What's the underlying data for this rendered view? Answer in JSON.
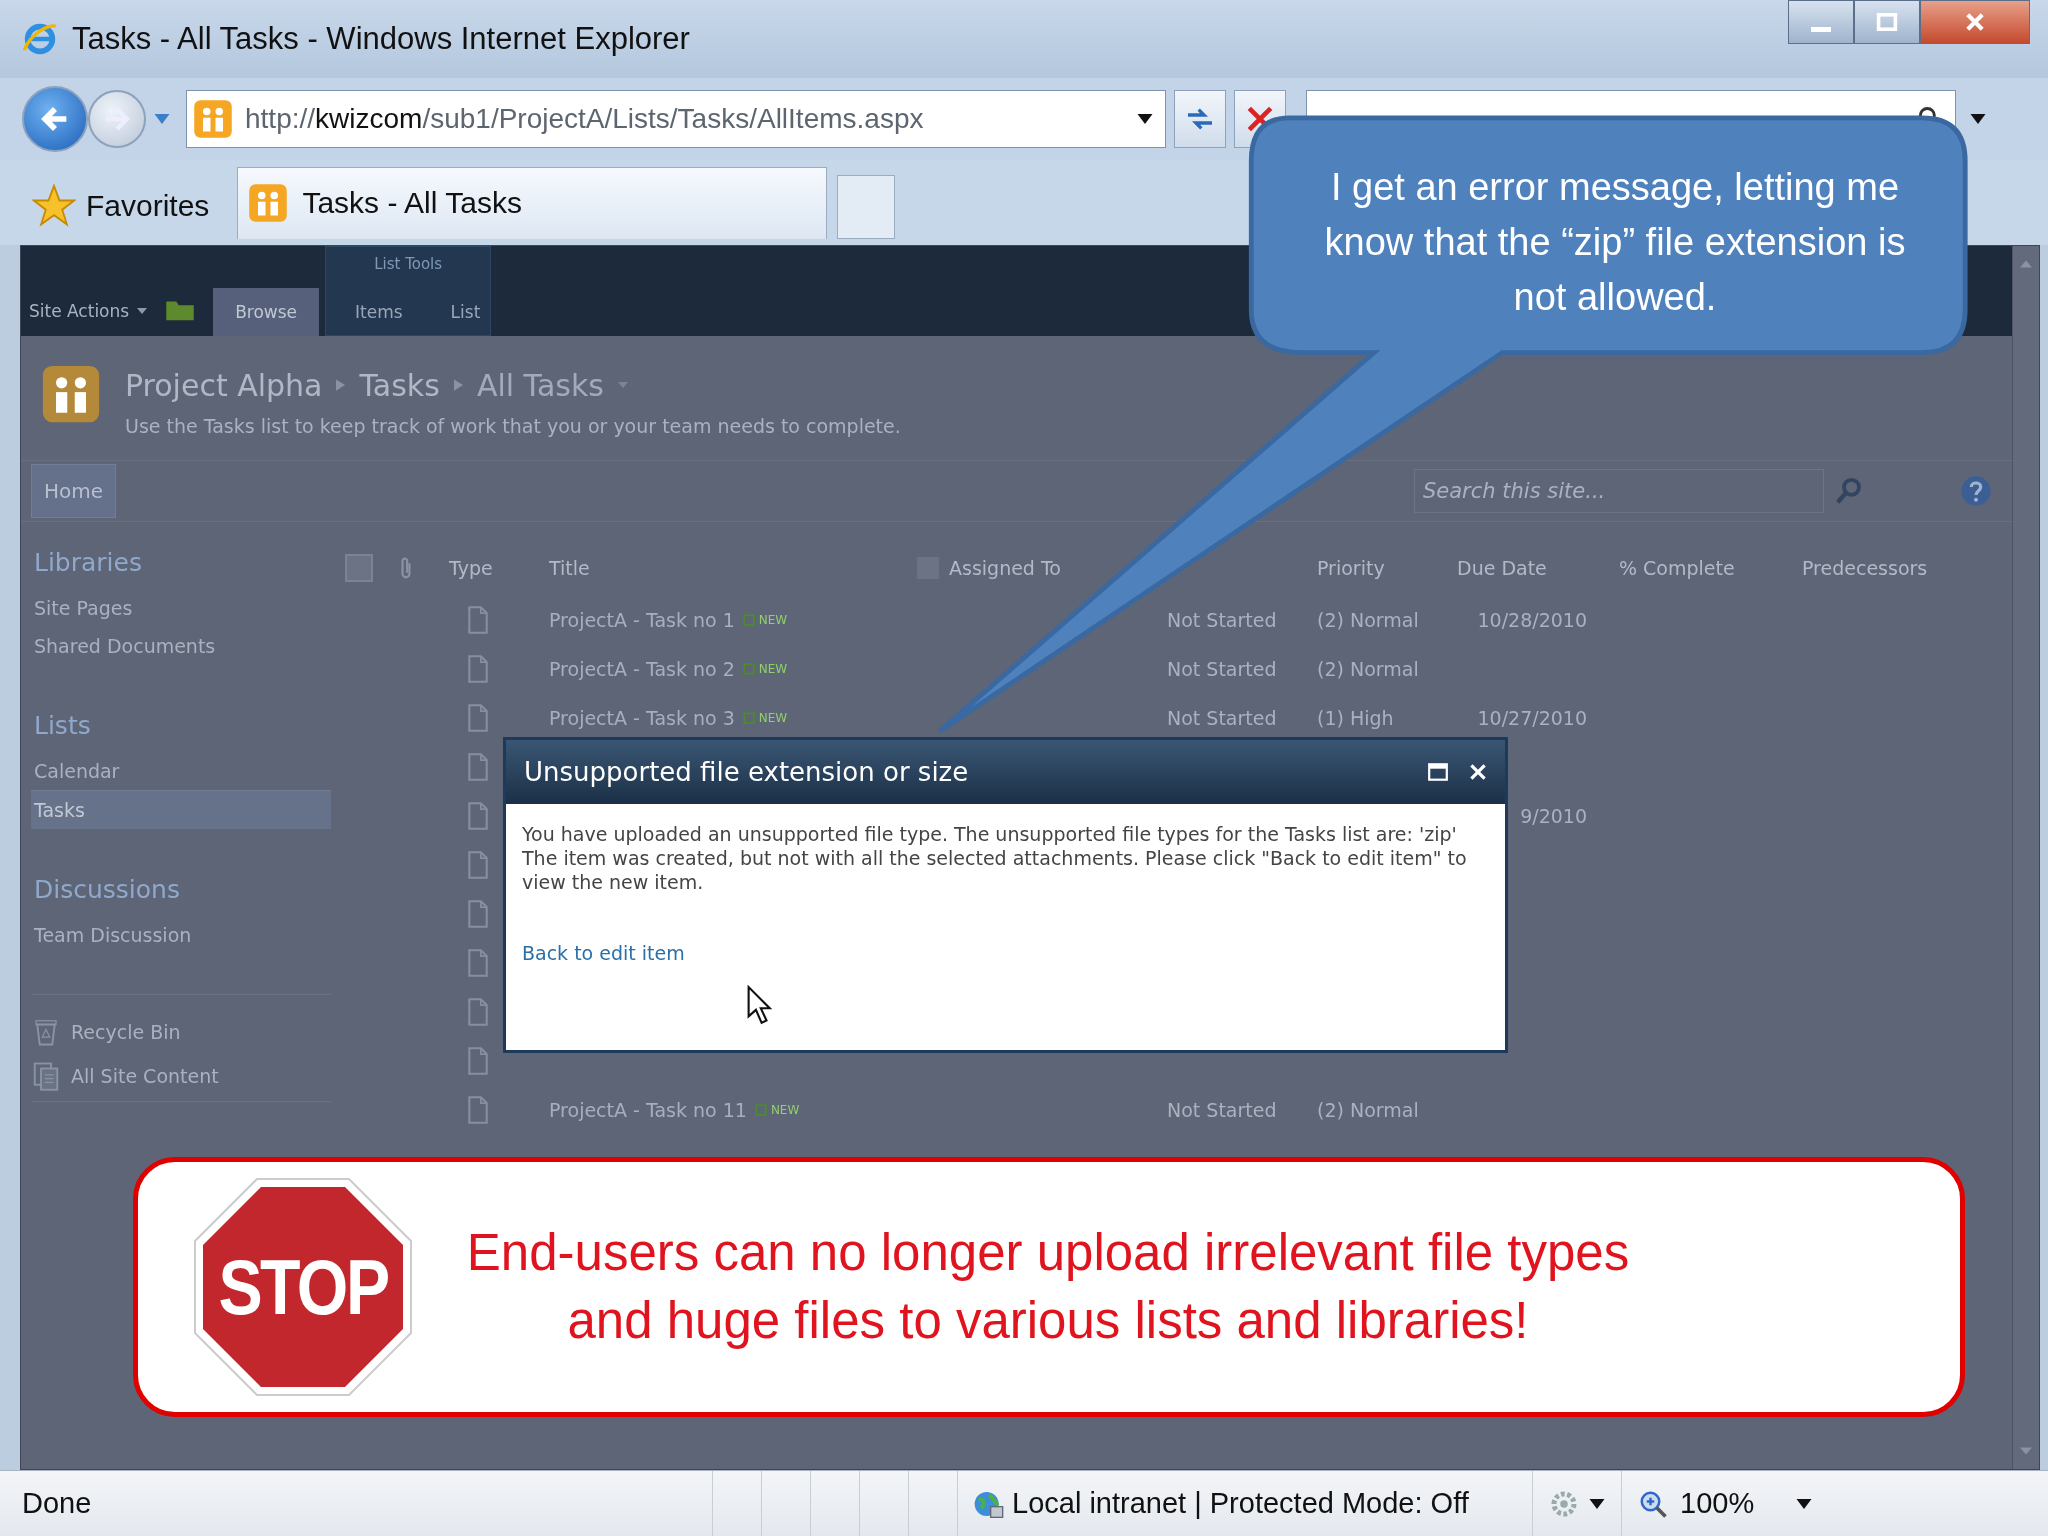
{
  "window": {
    "title": "Tasks - All Tasks - Windows Internet Explorer"
  },
  "address_bar": {
    "url": "http://**kwizcom**/sub1/ProjectA/Lists/Tasks/AllItems.aspx"
  },
  "favorites": "Favorites",
  "tabs": [
    {
      "label": "Tasks - All Tasks",
      "selected": true
    }
  ],
  "ribbon": {
    "site_actions": "Site Actions",
    "group_label": "List Tools",
    "tabs": [
      {
        "label": "Browse",
        "selected": true
      },
      {
        "label": "Items",
        "selected": false
      },
      {
        "label": "List",
        "selected": false
      }
    ]
  },
  "breadcrumb": [
    "Project Alpha",
    "Tasks",
    "All Tasks"
  ],
  "description": "Use the Tasks list to keep track of work that you or your team needs to complete.",
  "top_nav": [
    {
      "label": "Home",
      "selected": true
    }
  ],
  "search": {
    "placeholder": "Search this site..."
  },
  "quick_launch": [
    {
      "heading": "Libraries",
      "items": [
        {
          "label": "Site Pages",
          "selected": false
        },
        {
          "label": "Shared Documents",
          "selected": false
        }
      ]
    },
    {
      "heading": "Lists",
      "items": [
        {
          "label": "Calendar",
          "selected": false
        },
        {
          "label": "Tasks",
          "selected": true
        }
      ]
    },
    {
      "heading": "Discussions",
      "items": [
        {
          "label": "Team Discussion",
          "selected": false
        }
      ]
    }
  ],
  "utility_links": [
    {
      "kind": "recycle-bin",
      "label": "Recycle Bin"
    },
    {
      "kind": "site-content",
      "label": "All Site Content"
    }
  ],
  "table": {
    "select_all": {
      "checked": false
    },
    "assigned_filter": {
      "checked": false
    },
    "headers": {
      "type": "Type",
      "title": "Title",
      "assigned_to": "Assigned To",
      "priority": "Priority",
      "due_date": "Due Date",
      "complete": "% Complete",
      "predecessors": "Predecessors"
    },
    "rows": [
      {
        "kind": "document",
        "title": "ProjectA - Task no 1",
        "badge": "NEW",
        "status": "Not Started",
        "priority": "(2) Normal",
        "due_date": "10/28/2010"
      },
      {
        "kind": "document",
        "title": "ProjectA - Task no 2",
        "badge": "NEW",
        "status": "Not Started",
        "priority": "(2) Normal"
      },
      {
        "kind": "document",
        "title": "ProjectA - Task no 3",
        "badge": "NEW",
        "status": "Not Started",
        "priority": "(1) High",
        "due_date": "10/27/2010"
      },
      {
        "kind": "document"
      },
      {
        "kind": "document",
        "due_date": "9/2010"
      },
      {
        "kind": "document"
      },
      {
        "kind": "document"
      },
      {
        "kind": "document"
      },
      {
        "kind": "document"
      },
      {
        "kind": "document"
      },
      {
        "kind": "document",
        "title": "ProjectA - Task no 11",
        "badge": "NEW",
        "status": "Not Started",
        "priority": "(2) Normal"
      }
    ]
  },
  "dialog": {
    "title": "Unsupported file extension or size",
    "paragraphs": [
      "You have uploaded an unsupported file type. The unsupported file types for the Tasks list are: 'zip'",
      "The item was created, but not with all the selected attachments. Please click \"Back to edit item\" to view the new item."
    ],
    "link": "Back to edit item"
  },
  "callout": {
    "text": "I get an error message, letting me know that the “zip” file extension is not allowed."
  },
  "banner": {
    "sign": "STOP",
    "text": "End-users can no longer upload irrelevant file types and huge files to various lists and libraries!"
  },
  "status_bar": {
    "status": "Done",
    "zone": "Local intranet | Protected Mode: Off",
    "zoom": "100%"
  }
}
